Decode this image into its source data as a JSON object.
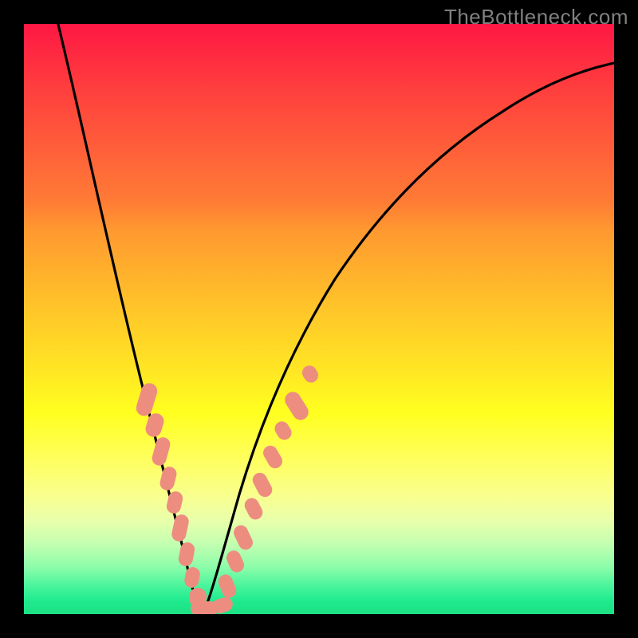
{
  "watermark": "TheBottleneck.com",
  "chart_data": {
    "type": "line",
    "title": "",
    "xlabel": "",
    "ylabel": "",
    "xlim": [
      0,
      100
    ],
    "ylim": [
      0,
      100
    ],
    "x": [
      0,
      3,
      6,
      9,
      12,
      15,
      18,
      20,
      22,
      24,
      25,
      26,
      27,
      28,
      29,
      30,
      31,
      33,
      35,
      38,
      42,
      46,
      50,
      55,
      60,
      65,
      70,
      75,
      80,
      85,
      90,
      95,
      100
    ],
    "values": [
      108,
      100,
      90,
      79,
      67,
      55,
      44,
      36,
      28,
      20,
      15,
      10,
      6,
      3,
      1,
      0,
      1,
      5,
      12,
      22,
      33,
      42,
      50,
      58,
      64,
      70,
      75,
      79,
      82,
      85,
      87,
      89,
      90
    ],
    "curve_minimum_x": 29,
    "marker_clusters": {
      "left_branch_x_range": [
        19,
        26
      ],
      "right_branch_x_range": [
        30,
        38
      ]
    },
    "background_gradient": {
      "top": "#ff1744",
      "mid_upper": "#ffb02c",
      "mid": "#ffff20",
      "mid_lower": "#c4ffb0",
      "bottom": "#1ce184"
    }
  }
}
